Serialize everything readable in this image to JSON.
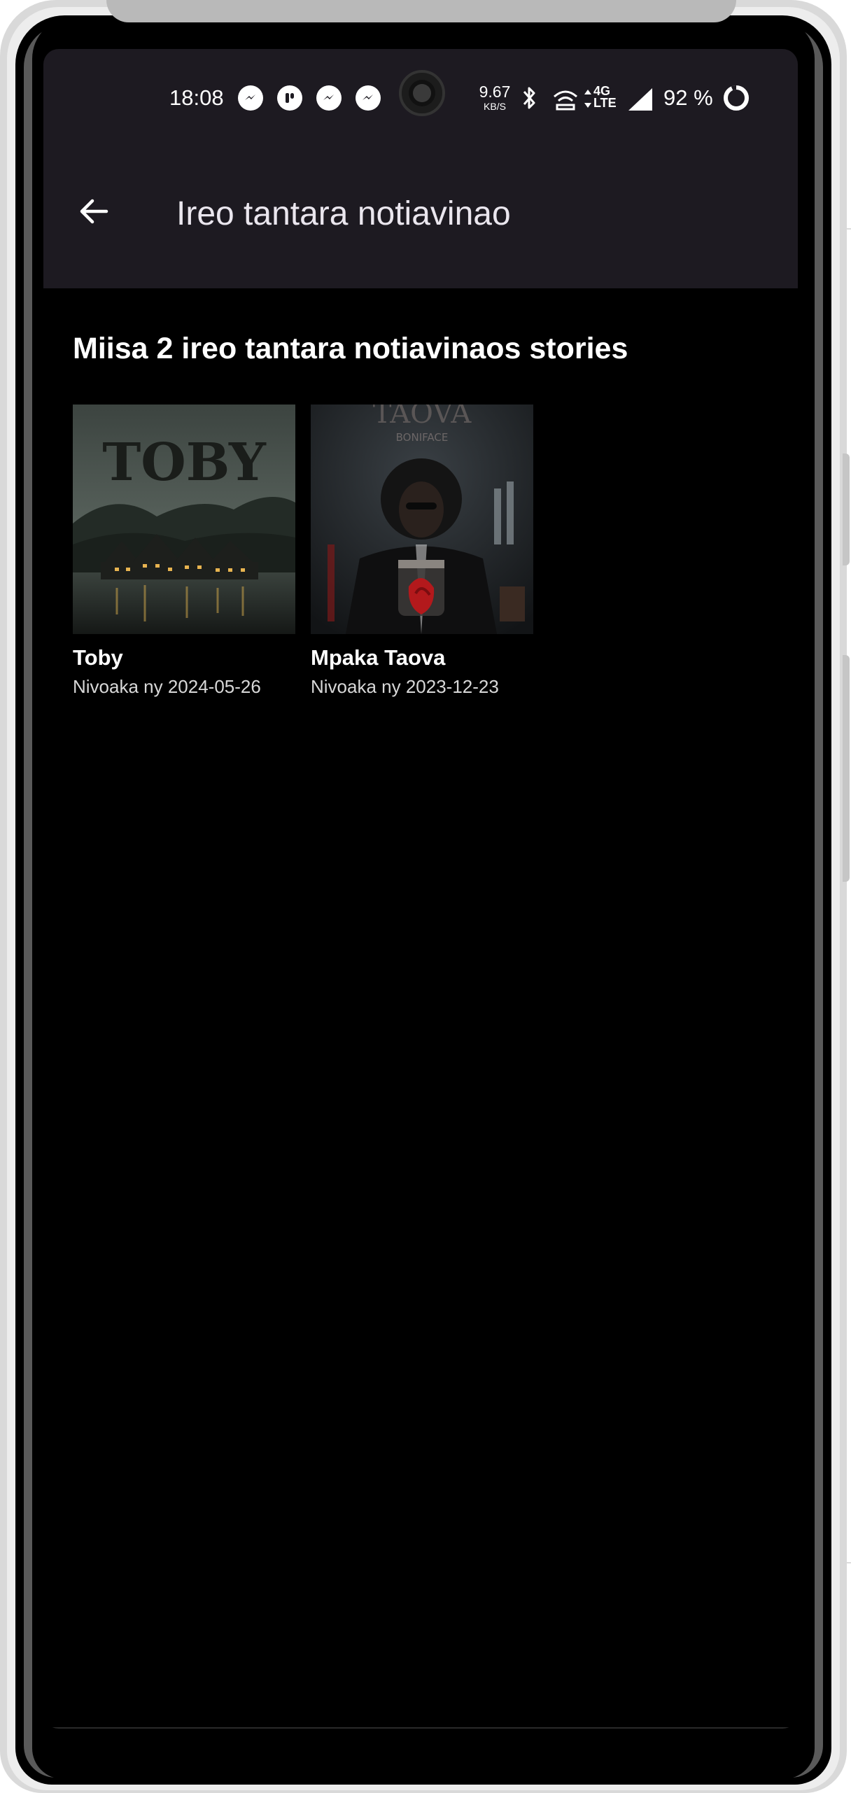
{
  "status_bar": {
    "time": "18:08",
    "notification_icons": [
      "messenger-icon",
      "app-icon",
      "messenger-icon",
      "messenger-icon"
    ],
    "net_speed_value": "9.67",
    "net_speed_unit": "KB/S",
    "network_type_top": "4G",
    "network_type_bottom": "LTE",
    "battery_percent": "92 %"
  },
  "app_bar": {
    "back_icon": "arrow-left-icon",
    "title": "Ireo tantara notiavinao"
  },
  "content": {
    "heading": "Miisa 2 ireo tantara notiavinaos stories",
    "stories": [
      {
        "title": "Toby",
        "date": "Nivoaka ny 2024-05-26",
        "cover_text": "TOBY"
      },
      {
        "title": "Mpaka Taova",
        "date": "Nivoaka ny 2023-12-23",
        "cover_text": "TAOVA",
        "cover_subtext": "BONIFACE"
      }
    ]
  },
  "colors": {
    "bar_background": "#1d1a21",
    "screen_background": "#000000",
    "text_primary": "#ffffff",
    "text_secondary": "#d8d8d8"
  }
}
